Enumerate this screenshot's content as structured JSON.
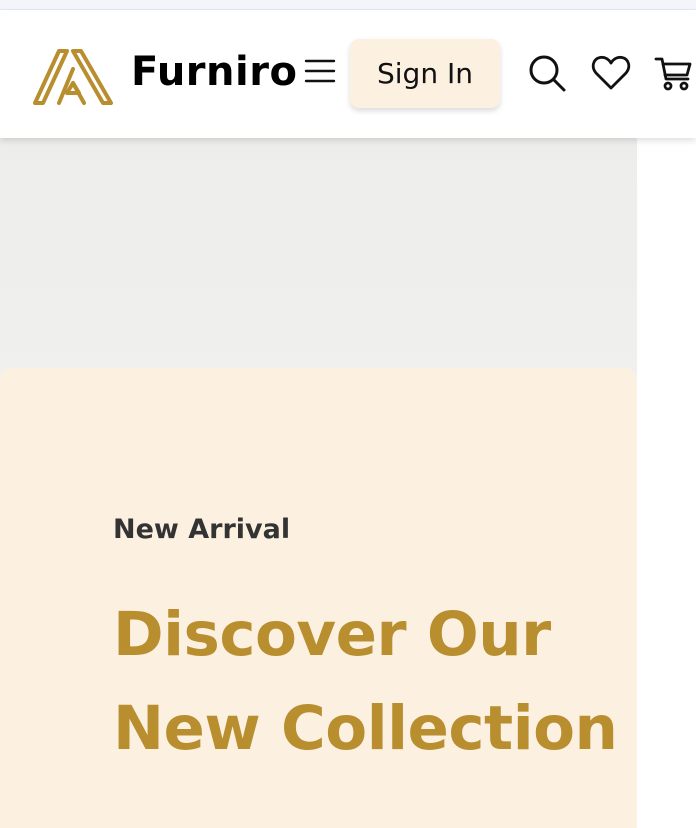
{
  "header": {
    "brand": "Furniro",
    "sign_in_label": "Sign In",
    "icons": [
      "logo-icon",
      "menu-icon",
      "search-icon",
      "heart-icon",
      "cart-icon"
    ]
  },
  "hero": {
    "subtitle": "New Arrival",
    "title_line1": "Discover Our",
    "title_line2": "New Collection"
  },
  "colors": {
    "accent": "#b88e2f",
    "card_bg": "#fcf0e1",
    "hero_bg": "#efefed"
  }
}
